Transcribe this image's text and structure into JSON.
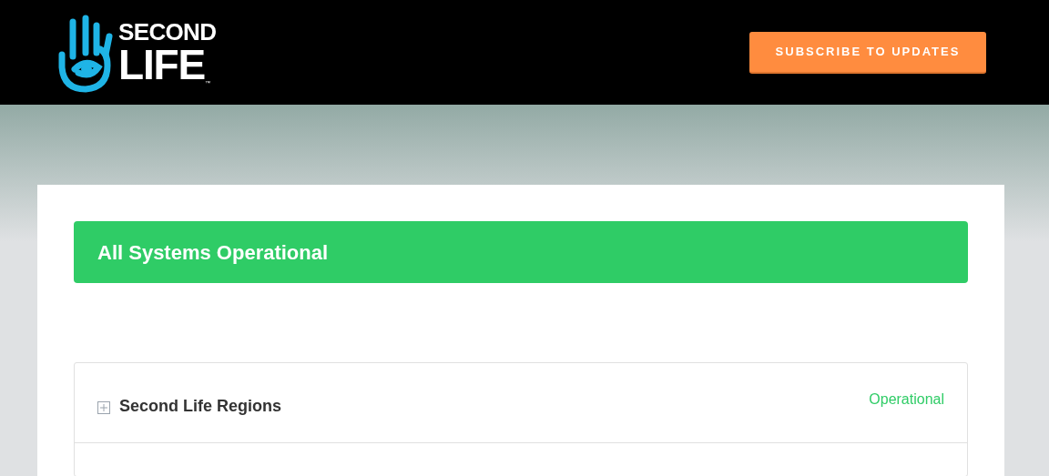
{
  "header": {
    "logo": {
      "line_1": "SECOND",
      "line_2": "LIFE",
      "mark": "™"
    },
    "subscribe_button": "SUBSCRIBE TO UPDATES"
  },
  "status_banner": {
    "text": "All Systems Operational",
    "color": "#2fcc66"
  },
  "components": [
    {
      "name": "Second Life Regions",
      "status": "Operational",
      "color": "#2fcc66",
      "expanded": false
    }
  ]
}
